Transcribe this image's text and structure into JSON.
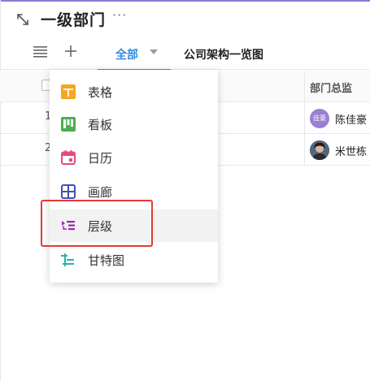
{
  "header": {
    "title": "一级部门",
    "more": "···"
  },
  "toolbar": {
    "tab_all_label": "全部",
    "tab_org_label": "公司架构一览图"
  },
  "table": {
    "column_header": "部门总监",
    "rows": [
      {
        "num": "1",
        "avatar_text": "佳豪",
        "user_name": "陈佳豪"
      },
      {
        "num": "2",
        "user_name": "米世栋"
      }
    ]
  },
  "dropdown": {
    "items": [
      {
        "label": "表格",
        "icon": "table-icon",
        "color": "#f5a623"
      },
      {
        "label": "看板",
        "icon": "kanban-icon",
        "color": "#4caf50"
      },
      {
        "label": "日历",
        "icon": "calendar-icon",
        "color": "#e84a7f"
      },
      {
        "label": "画廊",
        "icon": "gallery-icon",
        "color": "#3f51b5"
      },
      {
        "label": "层级",
        "icon": "hierarchy-icon",
        "color": "#9c27b0"
      },
      {
        "label": "甘特图",
        "icon": "gantt-icon",
        "color": "#26b5a8"
      }
    ],
    "hovered_index": 4
  },
  "colors": {
    "accent": "#2f8ee0",
    "highlight": "#e53935"
  }
}
